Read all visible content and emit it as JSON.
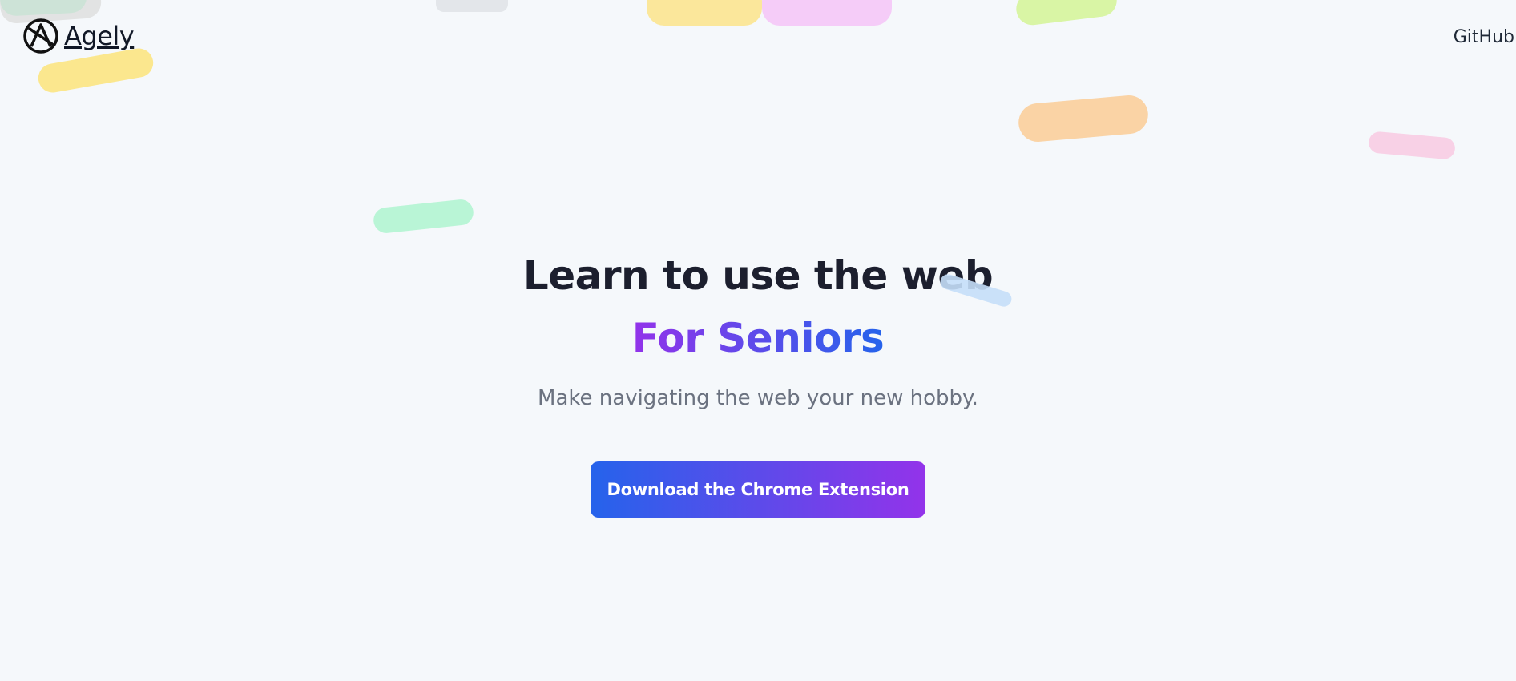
{
  "header": {
    "brand_name": "Agely",
    "logo_icon": "agely-logo-icon",
    "github_label": "GitHub"
  },
  "hero": {
    "title": "Learn to use the web",
    "accent": "For Seniors",
    "subtitle": "Make navigating the web your new hobby.",
    "cta_label": "Download the Chrome Extension"
  },
  "colors": {
    "background": "#f5f8fb",
    "text_dark": "#1c1f2e",
    "text_muted": "#6b7280",
    "gradient_purple": "#9333ea",
    "gradient_blue": "#2563eb"
  }
}
